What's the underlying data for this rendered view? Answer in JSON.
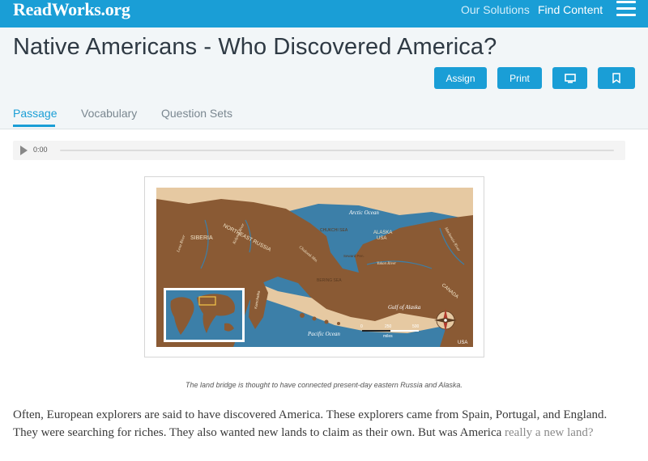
{
  "nav": {
    "logo": "ReadWorks.org",
    "links": [
      "Our Solutions",
      "Find Content"
    ],
    "menu_icon": "hamburger-icon"
  },
  "header": {
    "title": "Native Americans - Who Discovered America?",
    "buttons": {
      "assign": "Assign",
      "print": "Print",
      "present_icon": "monitor-icon",
      "bookmark_icon": "bookmark-icon"
    },
    "tabs": [
      "Passage",
      "Vocabulary",
      "Question Sets"
    ],
    "active_tab": "Passage"
  },
  "audio": {
    "play_icon": "play-icon",
    "time": "0:00"
  },
  "figure": {
    "map_labels": {
      "arctic": "Arctic Ocean",
      "siberia": "SIBERIA",
      "ne_russia": "NORTHEAST RUSSIA",
      "alaska": "ALASKA",
      "usa": "USA",
      "canada": "CANADA",
      "pacific": "Pacific Ocean",
      "gulf": "Gulf of Alaska",
      "bering": "BERING SEA",
      "chukchi": "CHUKCHI SEA",
      "yukon": "Yukon River",
      "mackenzie": "Mackenzie River",
      "kolyma": "Kolyma River",
      "lena": "Lena River",
      "seward": "Seward Pen.",
      "chukotsk": "Chukotsk Mts.",
      "kamchatka": "Kamchatka",
      "scale_0": "0",
      "scale_250": "250",
      "scale_500": "500",
      "scale_unit": "miles",
      "corner": "USA"
    },
    "caption": "The land bridge is thought to have connected present-day eastern Russia and Alaska."
  },
  "passage": {
    "visible": "Often, European explorers are said to have discovered America. These explorers came from Spain, Portugal, and England. They were searching for riches. They also wanted new lands to claim as their own. But was America",
    "faded": "really a new land?"
  },
  "colors": {
    "brand": "#1a9ed6",
    "header_bg": "#f2f6f8",
    "map_land": "#8a5a34",
    "map_shelf": "#e6c9a2",
    "map_ocean": "#3c7fa8"
  }
}
